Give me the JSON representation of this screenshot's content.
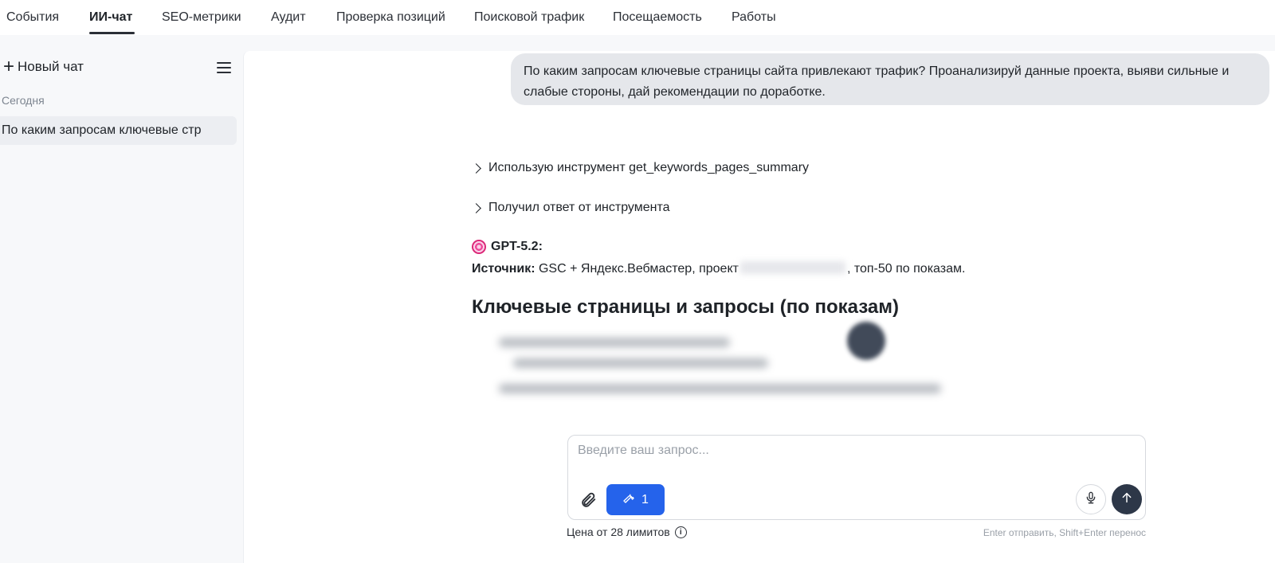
{
  "topnav": {
    "tabs": [
      {
        "label": "События",
        "active": false
      },
      {
        "label": "ИИ-чат",
        "active": true
      },
      {
        "label": "SEO-метрики",
        "active": false
      },
      {
        "label": "Аудит",
        "active": false
      },
      {
        "label": "Проверка позиций",
        "active": false
      },
      {
        "label": "Поисковой трафик",
        "active": false
      },
      {
        "label": "Посещаемость",
        "active": false
      },
      {
        "label": "Работы",
        "active": false
      }
    ]
  },
  "sidebar": {
    "new_chat_label": "Новый чат",
    "section_label": "Сегодня",
    "history": [
      {
        "label": "По каким запросам ключевые стр"
      }
    ]
  },
  "chat": {
    "user_message": "По каким запросам ключевые страницы сайта привлекают трафик? Проанализируй данные проекта, выяви сильные и слабые стороны, дай рекомендации по доработке.",
    "tool_calls": [
      {
        "label": "Использую инструмент get_keywords_pages_summary"
      },
      {
        "label": "Получил ответ от инструмента"
      }
    ],
    "model_name": "GPT-5.2:",
    "source_label": "Источник:",
    "source_text_before": "GSC + Яндекс.Вебмастер, проект",
    "source_text_after": ", топ-50 по показам.",
    "heading": "Ключевые страницы и запросы (по показам)"
  },
  "composer": {
    "placeholder": "Введите ваш запрос...",
    "value": "",
    "tools_count": "1",
    "price_label": "Цена от 28 лимитов",
    "hint": "Enter отправить, Shift+Enter перенос"
  },
  "colors": {
    "accent": "#2563eb",
    "send_button": "#2d3748",
    "bubble": "#e5e7eb"
  }
}
